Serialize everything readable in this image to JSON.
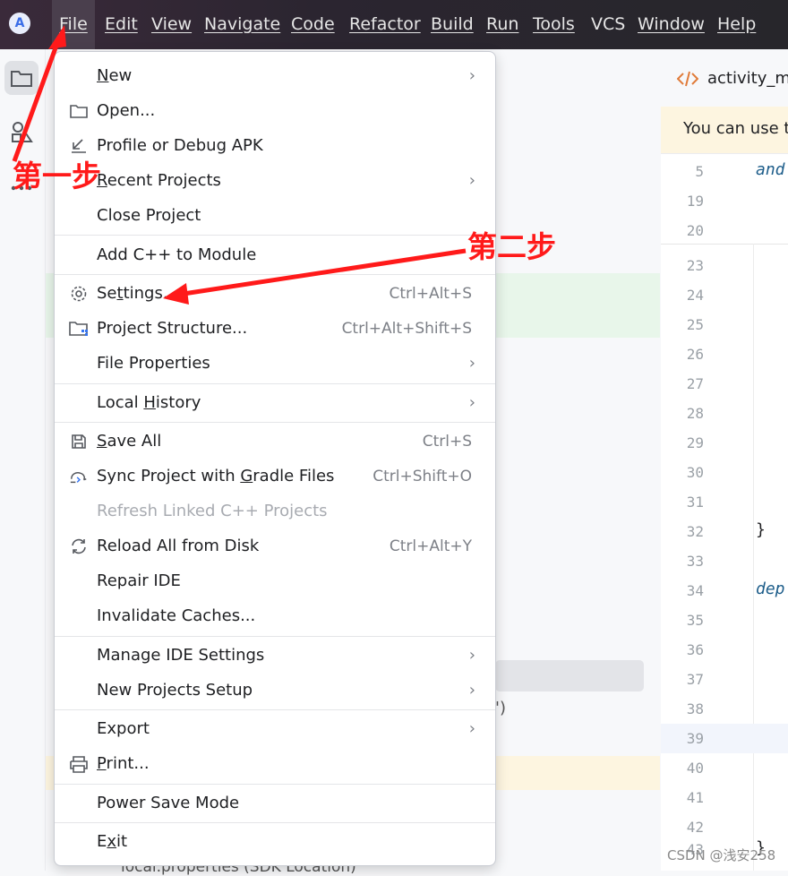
{
  "menubar": {
    "items": [
      "File",
      "Edit",
      "View",
      "Navigate",
      "Code",
      "Refactor",
      "Build",
      "Run",
      "Tools",
      "VCS",
      "Window",
      "Help"
    ],
    "active": "File"
  },
  "editor": {
    "tab_label": "activity_ma",
    "banner_text": "You can use th",
    "lines": [
      {
        "n": "5",
        "code": "and"
      },
      {
        "n": "19",
        "code": ""
      },
      {
        "n": "20",
        "code": ""
      },
      {
        "n": "23",
        "code": ""
      },
      {
        "n": "24",
        "code": ""
      },
      {
        "n": "25",
        "code": ""
      },
      {
        "n": "26",
        "code": ""
      },
      {
        "n": "27",
        "code": ""
      },
      {
        "n": "28",
        "code": ""
      },
      {
        "n": "29",
        "code": ""
      },
      {
        "n": "30",
        "code": ""
      },
      {
        "n": "31",
        "code": ""
      },
      {
        "n": "32",
        "code": "}"
      },
      {
        "n": "33",
        "code": ""
      },
      {
        "n": "34",
        "code": "dep"
      },
      {
        "n": "35",
        "code": ""
      },
      {
        "n": "36",
        "code": ""
      },
      {
        "n": "37",
        "code": ""
      },
      {
        "n": "38",
        "code": ""
      },
      {
        "n": "39",
        "code": ""
      },
      {
        "n": "40",
        "code": ""
      },
      {
        "n": "41",
        "code": ""
      },
      {
        "n": "42",
        "code": ""
      },
      {
        "n": "43",
        "code": "}"
      }
    ]
  },
  "project_panel": {
    "partial_text_1": "')",
    "partial_text_2": "local.properties (SDK Location)"
  },
  "file_menu": {
    "items": [
      {
        "label": "New",
        "shortcut": "",
        "submenu": true,
        "icon": "",
        "disabled": false
      },
      {
        "label": "Open...",
        "shortcut": "",
        "submenu": false,
        "icon": "folder-icon",
        "disabled": false
      },
      {
        "label": "Profile or Debug APK",
        "shortcut": "",
        "submenu": false,
        "icon": "profile-apk-icon",
        "disabled": false
      },
      {
        "label": "Recent Projects",
        "shortcut": "",
        "submenu": true,
        "icon": "",
        "disabled": false
      },
      {
        "label": "Close Project",
        "shortcut": "",
        "submenu": false,
        "icon": "",
        "disabled": false
      },
      {
        "label": "Add C++ to Module",
        "shortcut": "",
        "submenu": false,
        "icon": "",
        "disabled": false
      },
      {
        "label": "Settings...",
        "shortcut": "Ctrl+Alt+S",
        "submenu": false,
        "icon": "gear-icon",
        "disabled": false
      },
      {
        "label": "Project Structure...",
        "shortcut": "Ctrl+Alt+Shift+S",
        "submenu": false,
        "icon": "project-structure-icon",
        "disabled": false
      },
      {
        "label": "File Properties",
        "shortcut": "",
        "submenu": true,
        "icon": "",
        "disabled": false
      },
      {
        "label": "Local History",
        "shortcut": "",
        "submenu": true,
        "icon": "",
        "disabled": false
      },
      {
        "label": "Save All",
        "shortcut": "Ctrl+S",
        "submenu": false,
        "icon": "save-icon",
        "disabled": false
      },
      {
        "label": "Sync Project with Gradle Files",
        "shortcut": "Ctrl+Shift+O",
        "submenu": false,
        "icon": "gradle-sync-icon",
        "disabled": false
      },
      {
        "label": "Refresh Linked C++ Projects",
        "shortcut": "",
        "submenu": false,
        "icon": "",
        "disabled": true
      },
      {
        "label": "Reload All from Disk",
        "shortcut": "Ctrl+Alt+Y",
        "submenu": false,
        "icon": "reload-icon",
        "disabled": false
      },
      {
        "label": "Repair IDE",
        "shortcut": "",
        "submenu": false,
        "icon": "",
        "disabled": false
      },
      {
        "label": "Invalidate Caches...",
        "shortcut": "",
        "submenu": false,
        "icon": "",
        "disabled": false
      },
      {
        "label": "Manage IDE Settings",
        "shortcut": "",
        "submenu": true,
        "icon": "",
        "disabled": false
      },
      {
        "label": "New Projects Setup",
        "shortcut": "",
        "submenu": true,
        "icon": "",
        "disabled": false
      },
      {
        "label": "Export",
        "shortcut": "",
        "submenu": true,
        "icon": "",
        "disabled": false
      },
      {
        "label": "Print...",
        "shortcut": "",
        "submenu": false,
        "icon": "printer-icon",
        "disabled": false
      },
      {
        "label": "Power Save Mode",
        "shortcut": "",
        "submenu": false,
        "icon": "",
        "disabled": false
      },
      {
        "label": "Exit",
        "shortcut": "",
        "submenu": false,
        "icon": "",
        "disabled": false
      }
    ]
  },
  "annotations": {
    "step1": "第一步",
    "step2": "第二步",
    "color": "#ff1a1a"
  },
  "watermark": "CSDN @浅安258"
}
